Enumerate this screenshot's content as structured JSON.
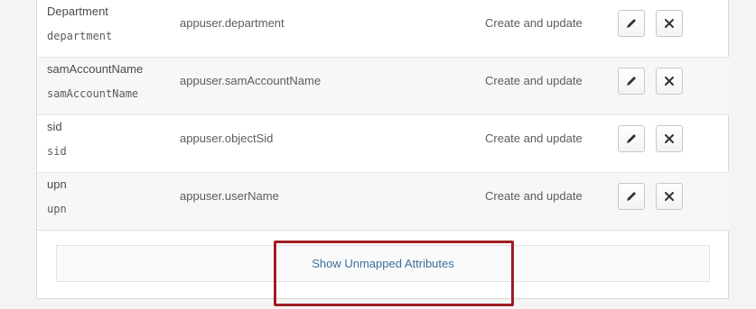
{
  "rows": [
    {
      "display_name": "Department",
      "variable_name": "department",
      "expression": "appuser.department",
      "apply_on": "Create and update"
    },
    {
      "display_name": "samAccountName",
      "variable_name": "samAccountName",
      "expression": "appuser.samAccountName",
      "apply_on": "Create and update"
    },
    {
      "display_name": "sid",
      "variable_name": "sid",
      "expression": "appuser.objectSid",
      "apply_on": "Create and update"
    },
    {
      "display_name": "upn",
      "variable_name": "upn",
      "expression": "appuser.userName",
      "apply_on": "Create and update"
    }
  ],
  "actions": {
    "edit_icon": "pencil-icon",
    "remove_icon": "close-icon"
  },
  "footer": {
    "show_unmapped_label": "Show Unmapped Attributes"
  },
  "colors": {
    "link": "#3d6e9b",
    "highlight_box": "#a01d22",
    "alt_row": "#f7f7f7"
  }
}
